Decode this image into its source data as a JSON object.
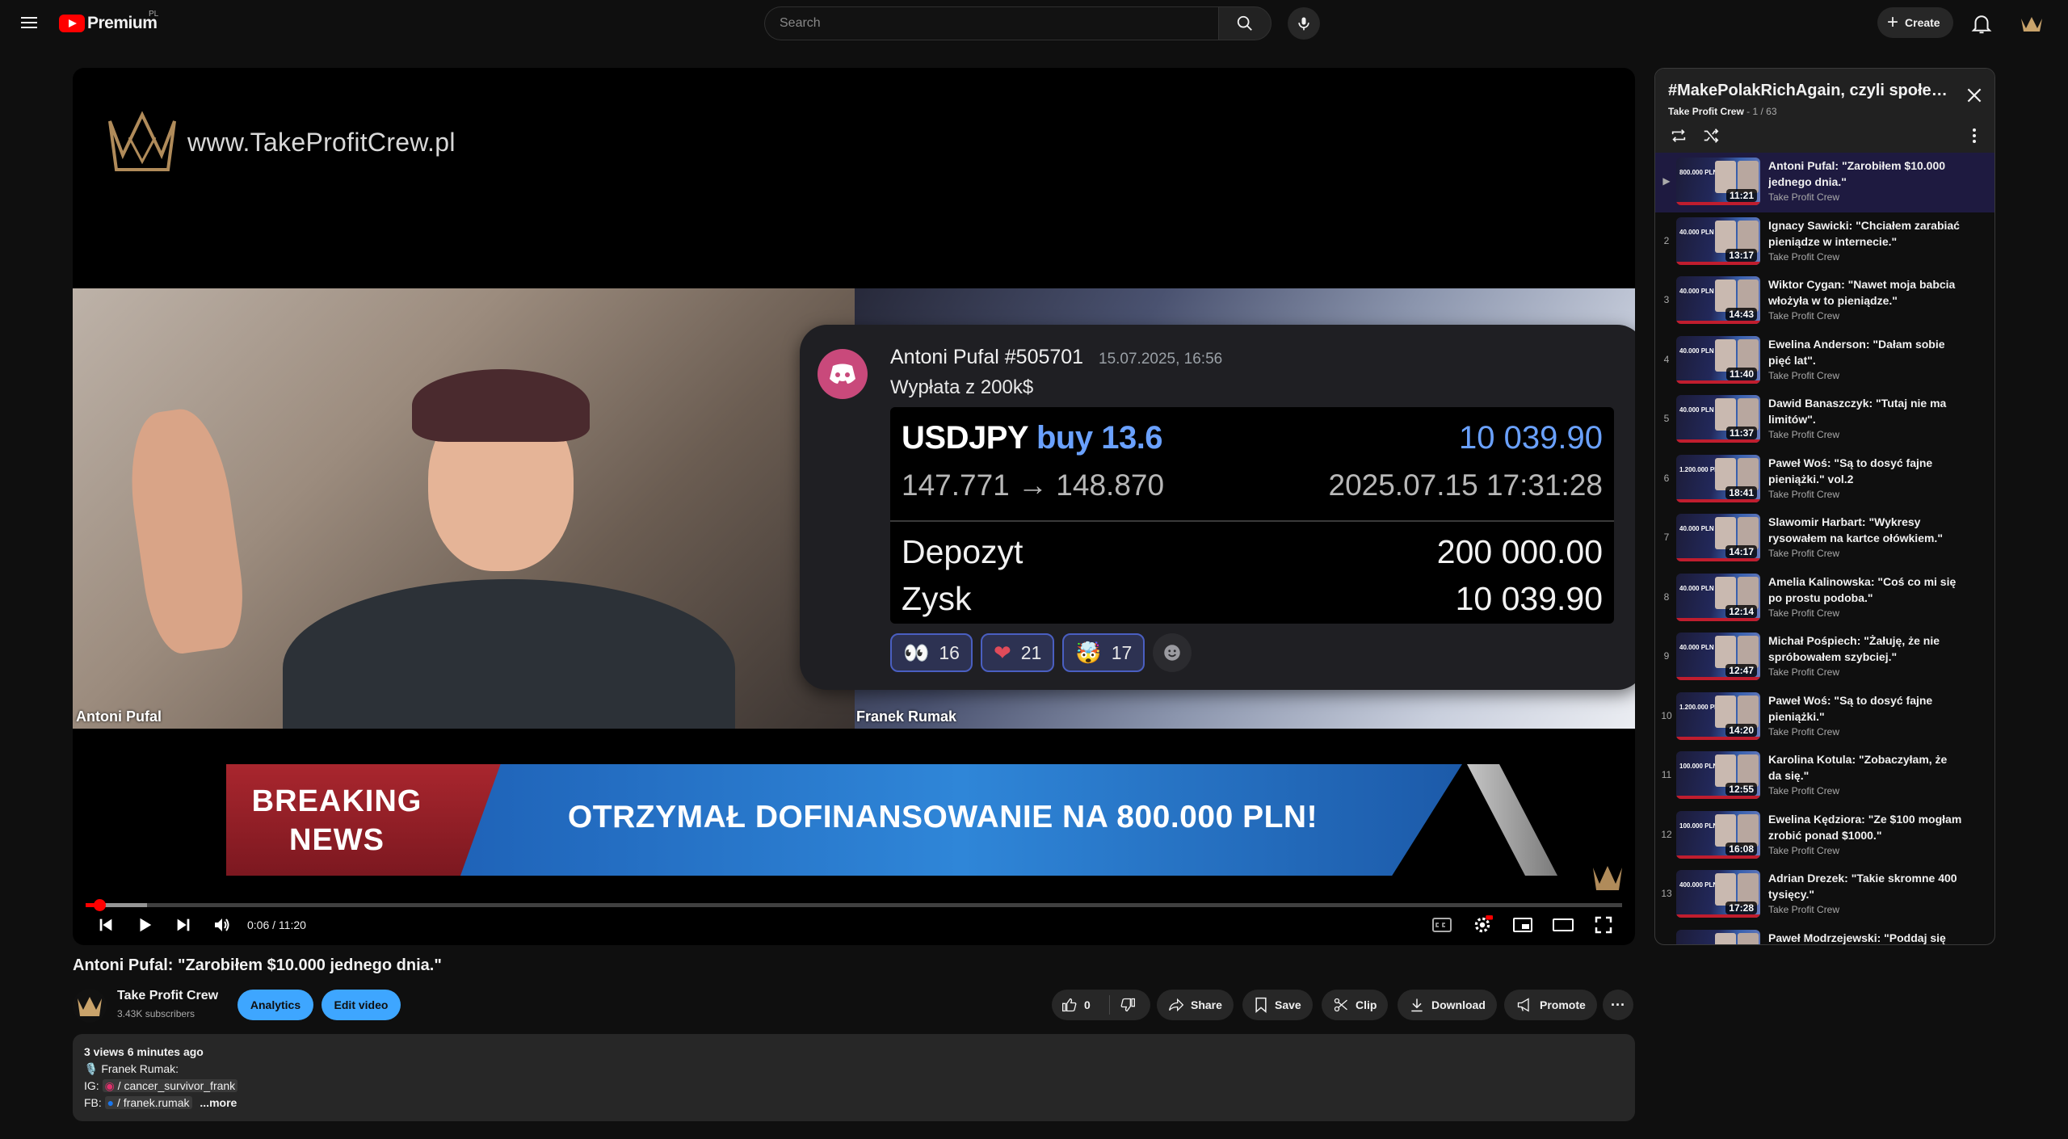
{
  "header": {
    "brand": "Premium",
    "region": "PL",
    "search_placeholder": "Search",
    "create_label": "Create"
  },
  "player": {
    "watermark_url": "www.TakeProfitCrew.pl",
    "left_cam_label": "Antoni Pufal",
    "right_cam_label": "Franek Rumak",
    "time": "0:06 / 11:20",
    "progress_fraction": 0.009,
    "discord": {
      "author": "Antoni Pufal #505701",
      "timestamp": "15.07.2025, 16:56",
      "subtitle": "Wypłata z 200k$",
      "pair": "USDJPY",
      "side": "buy 13.6",
      "amount": "10 039.90",
      "prices": "147.771 → 148.870",
      "datetime": "2025.07.15 17:31:28",
      "deposit_label": "Depozyt",
      "deposit_value": "200 000.00",
      "profit_label": "Zysk",
      "profit_value": "10 039.90",
      "reactions": [
        {
          "emoji": "👀",
          "count": "16"
        },
        {
          "emoji": "❤",
          "count": "21"
        },
        {
          "emoji": "🤯",
          "count": "17"
        }
      ]
    },
    "breaking": {
      "label_line1": "BREAKING",
      "label_line2": "NEWS",
      "headline": "OTRZYMAŁ DOFINANSOWANIE NA 800.000 PLN!"
    }
  },
  "video": {
    "title": "Antoni Pufal: \"Zarobiłem $10.000 jednego dnia.\"",
    "channel": "Take Profit Crew",
    "subscribers": "3.43K subscribers",
    "analytics_label": "Analytics",
    "edit_label": "Edit video",
    "likes": "0",
    "share_label": "Share",
    "save_label": "Save",
    "clip_label": "Clip",
    "download_label": "Download",
    "promote_label": "Promote"
  },
  "description": {
    "meta": "3 views  6 minutes ago",
    "line1": "Franek Rumak:",
    "ig_prefix": "IG:",
    "ig_handle": "/ cancer_survivor_frank",
    "fb_prefix": "FB:",
    "fb_handle": "/ franek.rumak",
    "more": "...more"
  },
  "playlist": {
    "title": "#MakePolakRichAgain, czyli społeczność Take Profit Crew",
    "owner": "Take Profit Crew",
    "position": "1 / 63",
    "items": [
      {
        "index": "▶",
        "title": "Antoni Pufal: \"Zarobiłem $10.000 jednego dnia.\"",
        "channel": "Take Profit Crew",
        "duration": "11:21",
        "thumb_amount": "800.000 PLN"
      },
      {
        "index": "2",
        "title": "Ignacy Sawicki: \"Chciałem zarabiać pieniądze w internecie.\"",
        "channel": "Take Profit Crew",
        "duration": "13:17",
        "thumb_amount": "40.000 PLN"
      },
      {
        "index": "3",
        "title": "Wiktor Cygan: \"Nawet moja babcia włożyła w to pieniądze.\"",
        "channel": "Take Profit Crew",
        "duration": "14:43",
        "thumb_amount": "40.000 PLN"
      },
      {
        "index": "4",
        "title": "Ewelina Anderson: \"Dałam sobie pięć lat\".",
        "channel": "Take Profit Crew",
        "duration": "11:40",
        "thumb_amount": "40.000 PLN"
      },
      {
        "index": "5",
        "title": "Dawid Banaszczyk: \"Tutaj nie ma limitów\".",
        "channel": "Take Profit Crew",
        "duration": "11:37",
        "thumb_amount": "40.000 PLN"
      },
      {
        "index": "6",
        "title": "Paweł Woś: \"Są to dosyć fajne pieniążki.\" vol.2",
        "channel": "Take Profit Crew",
        "duration": "18:41",
        "thumb_amount": "1.200.000 PLN"
      },
      {
        "index": "7",
        "title": "Slawomir Harbart: \"Wykresy rysowałem na kartce ołówkiem.\"",
        "channel": "Take Profit Crew",
        "duration": "14:17",
        "thumb_amount": "40.000 PLN"
      },
      {
        "index": "8",
        "title": "Amelia Kalinowska: \"Coś co mi się po prostu podoba.\"",
        "channel": "Take Profit Crew",
        "duration": "12:14",
        "thumb_amount": "40.000 PLN"
      },
      {
        "index": "9",
        "title": "Michał Pośpiech: \"Żałuję, że nie spróbowałem szybciej.\"",
        "channel": "Take Profit Crew",
        "duration": "12:47",
        "thumb_amount": "40.000 PLN"
      },
      {
        "index": "10",
        "title": "Paweł Woś: \"Są to dosyć fajne pieniążki.\"",
        "channel": "Take Profit Crew",
        "duration": "14:20",
        "thumb_amount": "1.200.000 PLN"
      },
      {
        "index": "11",
        "title": "Karolina Kotula: \"Zobaczyłam, że da się.\"",
        "channel": "Take Profit Crew",
        "duration": "12:55",
        "thumb_amount": "100.000 PLN"
      },
      {
        "index": "12",
        "title": "Ewelina Kędziora: \"Ze $100 mogłam zrobić ponad $1000.\"",
        "channel": "Take Profit Crew",
        "duration": "16:08",
        "thumb_amount": "100.000 PLN"
      },
      {
        "index": "13",
        "title": "Adrian Drezek: \"Takie skromne 400 tysięcy.\"",
        "channel": "Take Profit Crew",
        "duration": "17:28",
        "thumb_amount": "400.000 PLN"
      },
      {
        "index": "",
        "title": "Paweł Modrzejewski: \"Poddaj się",
        "channel": "",
        "duration": "",
        "thumb_amount": ""
      }
    ]
  },
  "colors": {
    "accent_blue": "#3ea6ff",
    "progress_red": "#ff0000",
    "active_item_bg": "#1e1a40"
  }
}
